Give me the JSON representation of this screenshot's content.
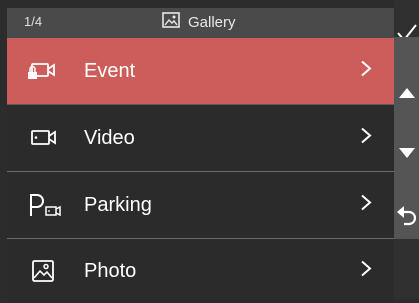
{
  "header": {
    "page_counter": "1/4",
    "title": "Gallery",
    "icon": "gallery-icon"
  },
  "menu": {
    "items": [
      {
        "label": "Event",
        "icon": "event-camera-icon",
        "active": true
      },
      {
        "label": "Video",
        "icon": "video-camera-icon",
        "active": false
      },
      {
        "label": "Parking",
        "icon": "parking-camera-icon",
        "active": false
      },
      {
        "label": "Photo",
        "icon": "photo-icon",
        "active": false
      }
    ]
  },
  "sidebar": {
    "buttons": [
      "confirm-check-icon",
      "up-arrow-icon",
      "down-arrow-icon",
      "back-return-icon"
    ]
  },
  "colors": {
    "active_row": "#cd5d5a",
    "background": "#2b2b2b",
    "header": "#4a4a4a",
    "sidebar_panel": "#555555"
  }
}
